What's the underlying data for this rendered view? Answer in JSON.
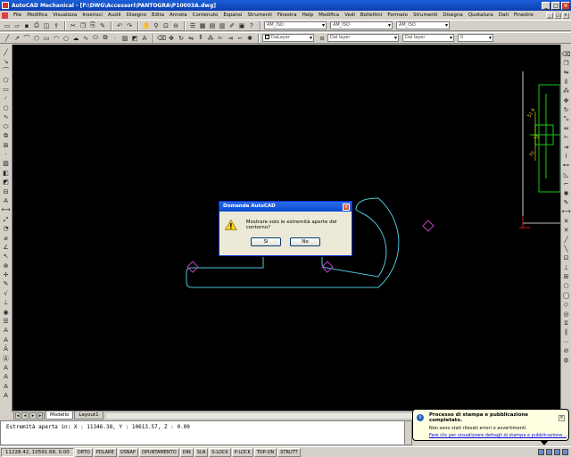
{
  "window": {
    "title": "AutoCAD Mechanical - [F:\\DWG\\Accessori\\PANTOGRA\\P10003A.dwg]",
    "controls": [
      "_",
      "□",
      "×"
    ]
  },
  "menubar": {
    "items": [
      "File",
      "Modifica",
      "Visualizza",
      "Inserisci",
      "Ausili",
      "Disegno",
      "Edita",
      "Annota",
      "Contenuto",
      "Espansi",
      "Strumenti",
      "Finestra",
      "Help",
      "Modifica",
      "Vedi",
      "Bollettini",
      "Formato",
      "Strumenti",
      "Disegna",
      "Quotatura",
      "Dati",
      "Finestre"
    ]
  },
  "toolbar": {
    "style_combo": "AM_ISO",
    "layer_combo": "0",
    "linetype_combo": "Dal layer",
    "lineweight_combo": "Dal layer",
    "color_combo": "DaLayer"
  },
  "dialog": {
    "title": "Domanda AutoCAD",
    "close": "×",
    "message": "Mostrare solo le estremità aperte del contorno?",
    "yes": "Sì",
    "no": "No"
  },
  "tabs": {
    "model": "Modello",
    "layout": "Layout1"
  },
  "command_line": {
    "text": "Estremità aperta in:   X : 11346.38,      Y : 10613.57,    Z :     0.00"
  },
  "status_bar": {
    "coords": "11228.42, 10591.68, 0.00",
    "buttons": [
      "ORTO",
      "POLARE",
      "OSNAP",
      "OPUNTAMENTO",
      "DIN",
      "SLN",
      "S-LOCK",
      "P-LOCK",
      "TOP-ON",
      "STRUTT"
    ]
  },
  "balloon": {
    "title": "Processo di stampa e pubblicazione completato.",
    "text": "Non sono stati rilevati errori o avvertimenti.",
    "link": "Fare clic per visualizzare dettagli di stampa e pubblicazione...",
    "close": "×"
  },
  "drawing": {
    "dims": [
      "51.6",
      "25",
      "70"
    ]
  },
  "colors": {
    "canvas": "#000000",
    "contour": "#4fc3d8",
    "marker": "#c040c0",
    "title_blue": "#0a3fb0",
    "drawing_green": "#19c819",
    "drawing_yellow": "#e0d020"
  }
}
